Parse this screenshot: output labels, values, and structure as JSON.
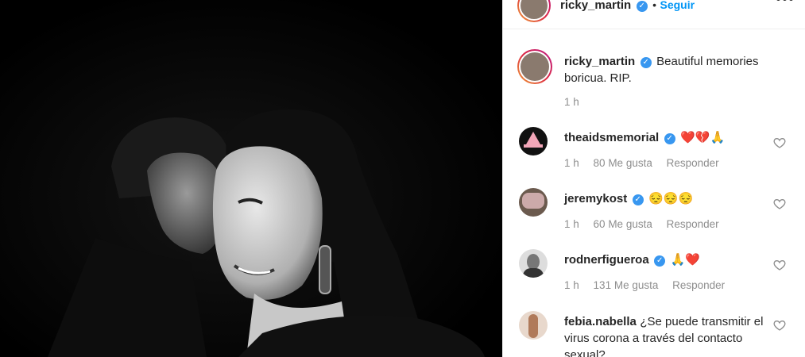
{
  "header": {
    "username": "ricky_martin",
    "separator": "•",
    "follow_label": "Seguir",
    "more_icon": "more-icon"
  },
  "caption": {
    "username": "ricky_martin",
    "text": "Beautiful memories boricua. RIP.",
    "time": "1 h"
  },
  "comments": [
    {
      "username": "theaidsmemorial",
      "verified": true,
      "text": "❤️💔🙏",
      "time": "1 h",
      "likes": "80 Me gusta",
      "reply": "Responder"
    },
    {
      "username": "jeremykost",
      "verified": true,
      "text": "😔😔😔",
      "time": "1 h",
      "likes": "60 Me gusta",
      "reply": "Responder"
    },
    {
      "username": "rodnerfigueroa",
      "verified": true,
      "text": "🙏❤️",
      "time": "1 h",
      "likes": "131 Me gusta",
      "reply": "Responder"
    },
    {
      "username": "febia.nabella",
      "verified": false,
      "text": "¿Se puede transmitir el virus corona a través del contacto sexual?",
      "time": "",
      "likes": "",
      "reply": ""
    }
  ],
  "colors": {
    "verified": "#3897f0",
    "follow": "#0095f6",
    "heart": "#ed4956",
    "meta": "#8e8e8e"
  }
}
